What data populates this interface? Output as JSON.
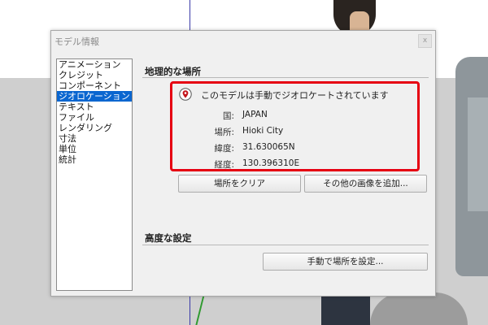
{
  "dialog": {
    "title": "モデル情報",
    "close_label": "x"
  },
  "sidebar": {
    "items": [
      {
        "label": "アニメーション",
        "selected": false
      },
      {
        "label": "クレジット",
        "selected": false
      },
      {
        "label": "コンポーネント",
        "selected": false
      },
      {
        "label": "ジオロケーション",
        "selected": true
      },
      {
        "label": "テキスト",
        "selected": false
      },
      {
        "label": "ファイル",
        "selected": false
      },
      {
        "label": "レンダリング",
        "selected": false
      },
      {
        "label": "寸法",
        "selected": false
      },
      {
        "label": "単位",
        "selected": false
      },
      {
        "label": "統計",
        "selected": false
      }
    ]
  },
  "geo": {
    "section_title": "地理的な場所",
    "status": "このモデルは手動でジオロケートされています",
    "rows": [
      {
        "label": "国:",
        "value": "JAPAN"
      },
      {
        "label": "場所:",
        "value": "Hioki City"
      },
      {
        "label": "緯度:",
        "value": "31.630065N"
      },
      {
        "label": "経度:",
        "value": "130.396310E"
      }
    ],
    "clear_button": "場所をクリア",
    "add_imagery_button": "その他の画像を追加..."
  },
  "advanced": {
    "section_title": "高度な設定",
    "set_manual_button": "手動で場所を設定..."
  },
  "colors": {
    "highlight_border": "#e60012",
    "selection": "#0a66d0",
    "pin_red": "#c4161c"
  }
}
